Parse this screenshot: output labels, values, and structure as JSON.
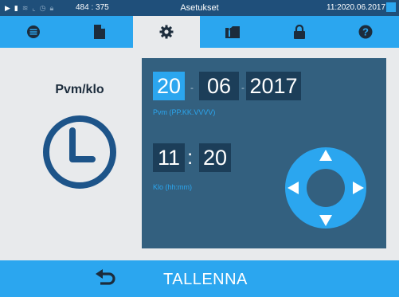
{
  "statusbar": {
    "coords": "484 : 375",
    "title": "Asetukset",
    "time": "11:20",
    "date": "20.06.2017",
    "icons": [
      "play-icon",
      "document-icon",
      "steam-icon",
      "graph-icon",
      "clock-icon",
      "lock-icon"
    ]
  },
  "tabs": [
    {
      "icon": "menu-list-icon",
      "active": false
    },
    {
      "icon": "document-icon",
      "active": false
    },
    {
      "icon": "gear-icon",
      "active": true
    },
    {
      "icon": "info-folder-icon",
      "active": false
    },
    {
      "icon": "lock-icon",
      "active": false
    },
    {
      "icon": "help-icon",
      "active": false
    }
  ],
  "left": {
    "title": "Pvm/klo",
    "icon": "clock-icon"
  },
  "date": {
    "day": "20",
    "month": "06",
    "year": "2017",
    "sep": "-",
    "hint": "Pvm (PP.KK.VVVV)"
  },
  "clock": {
    "hours": "11",
    "minutes": "20",
    "sep": ":",
    "hint": "Klo (hh:mm)"
  },
  "dpad": {
    "icons": [
      "arrow-up-icon",
      "arrow-down-icon",
      "arrow-left-icon",
      "arrow-right-icon"
    ]
  },
  "footer": {
    "save_label": "TALLENNA",
    "back_icon": "back-arrow-icon"
  },
  "colors": {
    "accent": "#2ba6ef",
    "statusbar": "#1f4f7a",
    "panel": "#33607f",
    "field": "#1c3e59",
    "clock": "#1d5489"
  }
}
